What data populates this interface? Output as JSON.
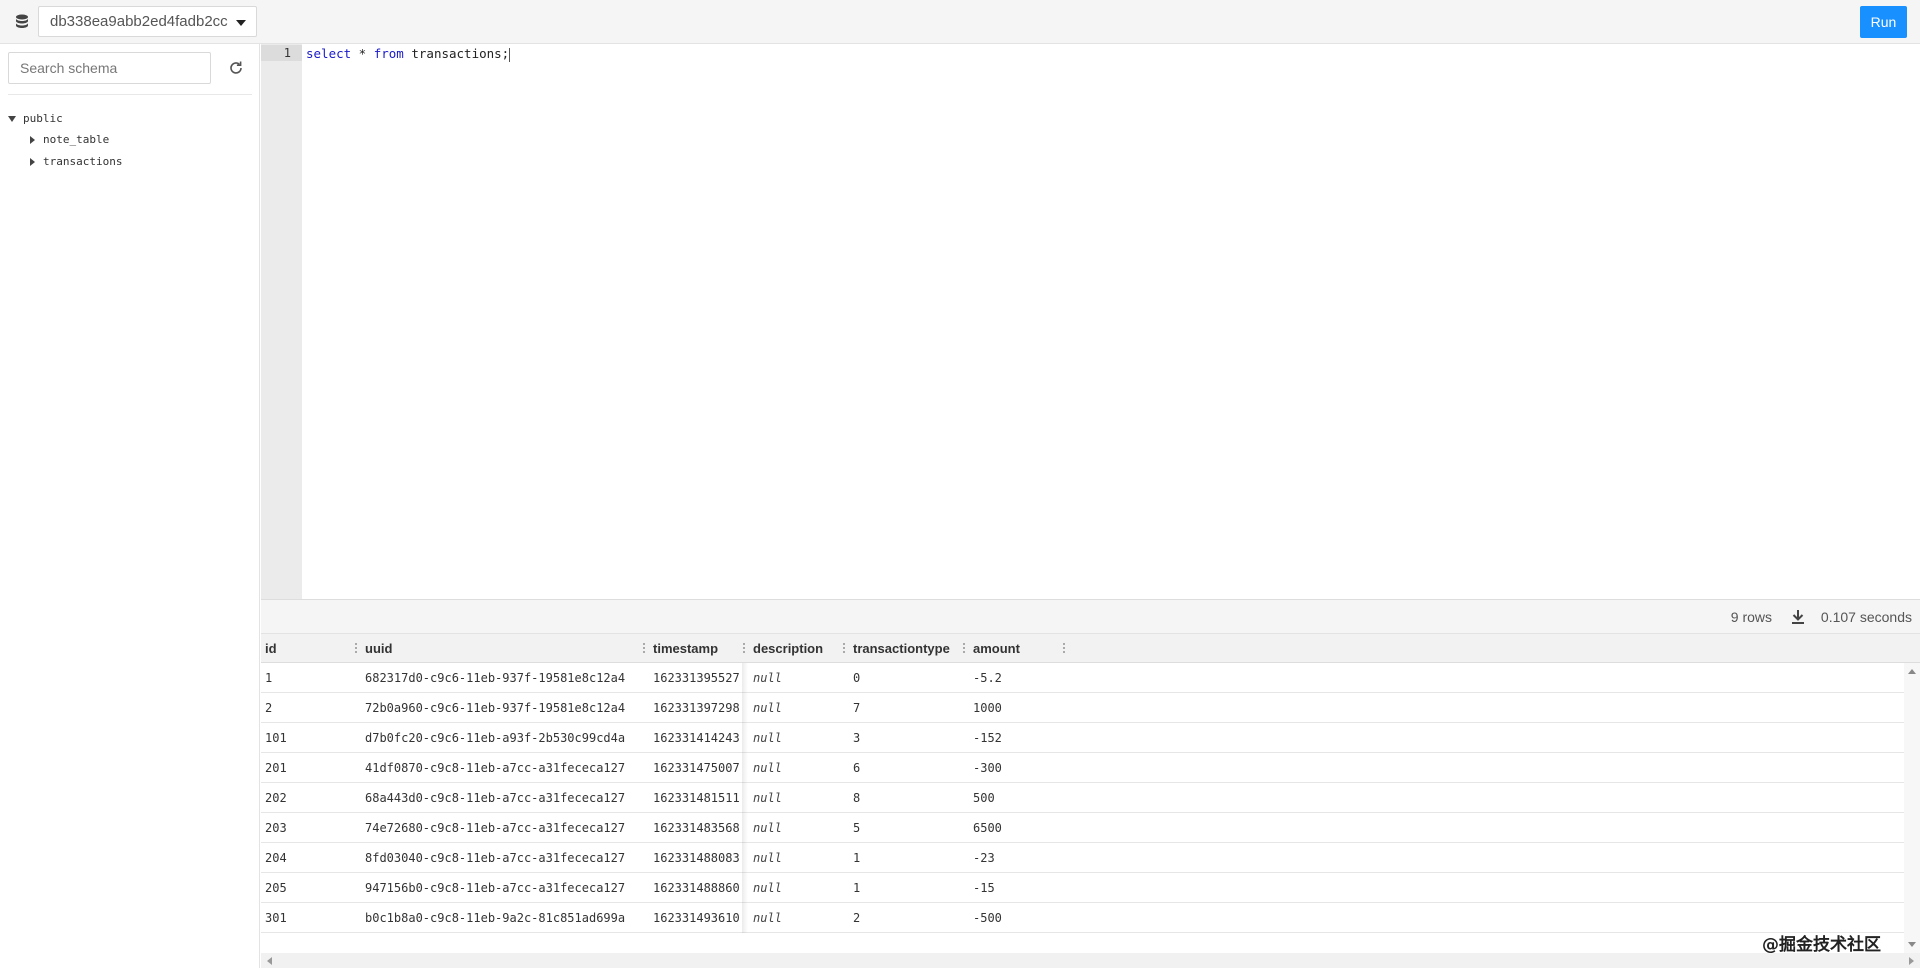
{
  "header": {
    "database": "db338ea9abb2ed4fadb2cc",
    "run_label": "Run"
  },
  "sidebar": {
    "search_placeholder": "Search schema",
    "schema": "public",
    "tables": [
      "note_table",
      "transactions"
    ]
  },
  "editor": {
    "line_number": "1",
    "kw_select": "select",
    "star": " * ",
    "kw_from": "from",
    "rest": " transactions;"
  },
  "results": {
    "rows_label": "9 rows",
    "elapsed": "0.107 seconds",
    "columns": [
      "id",
      "uuid",
      "timestamp",
      "description",
      "transactiontype",
      "amount"
    ],
    "rows": [
      [
        "1",
        "682317d0-c9c6-11eb-937f-19581e8c12a4",
        "162331395527",
        "null",
        "0",
        "-5.2"
      ],
      [
        "2",
        "72b0a960-c9c6-11eb-937f-19581e8c12a4",
        "162331397298",
        "null",
        "7",
        "1000"
      ],
      [
        "101",
        "d7b0fc20-c9c6-11eb-a93f-2b530c99cd4a",
        "162331414243",
        "null",
        "3",
        "-152"
      ],
      [
        "201",
        "41df0870-c9c8-11eb-a7cc-a31fececa127",
        "162331475007",
        "null",
        "6",
        "-300"
      ],
      [
        "202",
        "68a443d0-c9c8-11eb-a7cc-a31fececa127",
        "162331481511",
        "null",
        "8",
        "500"
      ],
      [
        "203",
        "74e72680-c9c8-11eb-a7cc-a31fececa127",
        "162331483568",
        "null",
        "5",
        "6500"
      ],
      [
        "204",
        "8fd03040-c9c8-11eb-a7cc-a31fececa127",
        "162331488083",
        "null",
        "1",
        "-23"
      ],
      [
        "205",
        "947156b0-c9c8-11eb-a7cc-a31fececa127",
        "162331488860",
        "null",
        "1",
        "-15"
      ],
      [
        "301",
        "b0c1b8a0-c9c8-11eb-9a2c-81c851ad699a",
        "162331493610",
        "null",
        "2",
        "-500"
      ]
    ]
  },
  "watermark": "@掘金技术社区",
  "colors": {
    "accent": "#1890ff",
    "keyword": "#1a1ac9"
  }
}
